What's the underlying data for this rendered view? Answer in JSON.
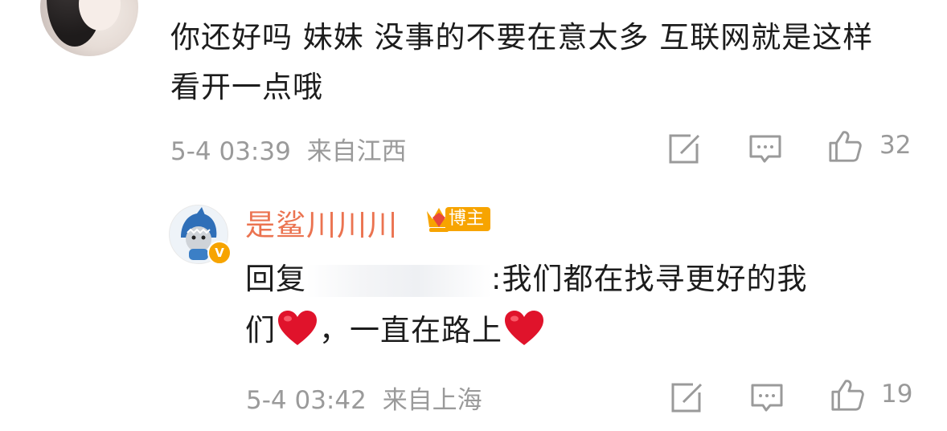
{
  "comment1": {
    "text": "你还好吗 妹妹 没事的不要在意太多 互联网就是这样 看开一点哦",
    "time": "5-4 03:39",
    "location": "来自江西",
    "likes": "32",
    "icons": [
      "share-icon",
      "comment-icon",
      "like-icon"
    ]
  },
  "reply1": {
    "username": "是鲨川川川",
    "badge": "博主",
    "verified_mark": "V",
    "prefix": "回复",
    "text_line1": ":我们都在找寻更好的我",
    "text_line2a": "们",
    "text_line2b": "，一直在路上",
    "time": "5-4 03:42",
    "location": "来自上海",
    "likes": "19",
    "colors": {
      "username": "#eb7350",
      "badge": "#f7a400",
      "heart": "#e0132b"
    }
  }
}
